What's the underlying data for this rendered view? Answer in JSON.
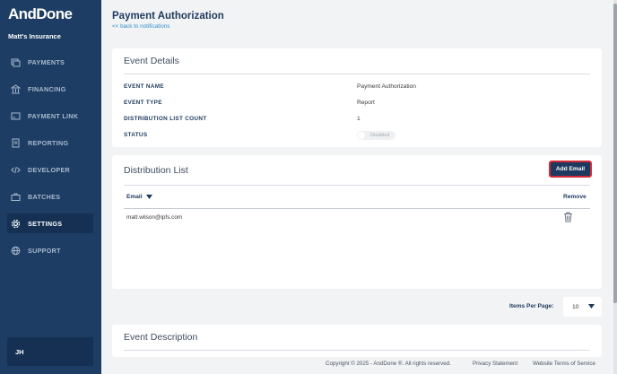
{
  "brand": {
    "logo_text": "AndDone",
    "org_name": "Matt's Insurance"
  },
  "sidebar": {
    "items": [
      {
        "label": "PAYMENTS",
        "icon": "payments-icon",
        "active": false
      },
      {
        "label": "FINANCING",
        "icon": "bank-icon",
        "active": false
      },
      {
        "label": "PAYMENT LINK",
        "icon": "payment-link-icon",
        "active": false
      },
      {
        "label": "REPORTING",
        "icon": "report-icon",
        "active": false
      },
      {
        "label": "DEVELOPER",
        "icon": "code-icon",
        "active": false
      },
      {
        "label": "BATCHES",
        "icon": "briefcase-icon",
        "active": false
      },
      {
        "label": "SETTINGS",
        "icon": "gear-icon",
        "active": true
      },
      {
        "label": "SUPPORT",
        "icon": "globe-icon",
        "active": false
      }
    ],
    "user_initials": "JH"
  },
  "header": {
    "title": "Payment Authorization",
    "back_link": "<< back to notifications"
  },
  "event_details": {
    "title": "Event Details",
    "fields": [
      {
        "label": "EVENT NAME",
        "value": "Payment Authorization"
      },
      {
        "label": "EVENT TYPE",
        "value": "Report"
      },
      {
        "label": "DISTRIBUTION LIST COUNT",
        "value": "1"
      },
      {
        "label": "STATUS",
        "value": "Disabled"
      }
    ]
  },
  "distribution_list": {
    "title": "Distribution List",
    "add_button": "Add Email",
    "columns": {
      "email": "Email",
      "remove": "Remove"
    },
    "rows": [
      {
        "email": "matt.wilson@ipfs.com"
      }
    ]
  },
  "pagination": {
    "items_per_page_label": "Items Per Page:",
    "items_per_page_value": "10"
  },
  "event_description": {
    "title": "Event Description"
  },
  "footer": {
    "copyright": "Copyright © 2025 - AndDone ®. All rights reserved.",
    "privacy": "Privacy Statement",
    "terms": "Website Terms of Service"
  },
  "colors": {
    "sidebar_bg": "#1d3d64",
    "sidebar_active": "#153052",
    "accent_navy": "#1d3a5e",
    "link_blue": "#2f8fd0",
    "highlight_red": "#d42a38"
  }
}
